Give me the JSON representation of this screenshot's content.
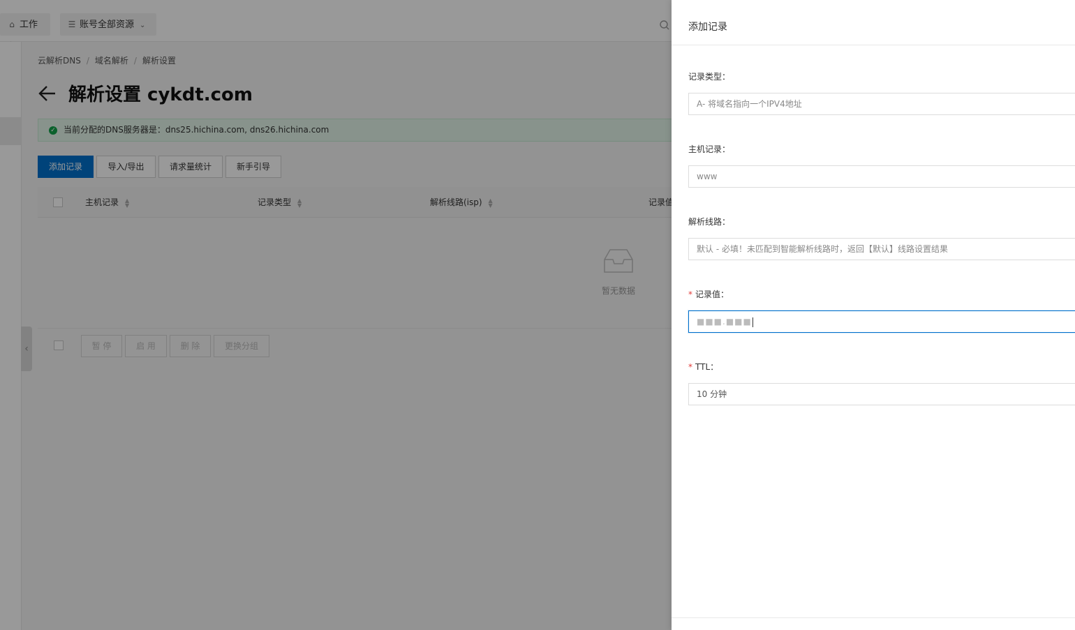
{
  "topbar": {
    "home_label": "工作台",
    "resource_label": "账号全部资源"
  },
  "breadcrumb": [
    "云解析DNS",
    "域名解析",
    "解析设置"
  ],
  "page": {
    "title": "解析设置 cykdt.com"
  },
  "alert": {
    "text": "当前分配的DNS服务器是：dns25.hichina.com, dns26.hichina.com"
  },
  "actions": {
    "add_record": "添加记录",
    "import_export": "导入/导出",
    "request_stats": "请求量统计",
    "guide": "新手引导"
  },
  "table": {
    "columns": [
      "主机记录",
      "记录类型",
      "解析线路(isp)",
      "记录值"
    ],
    "empty_text": "暂无数据",
    "bulk_actions": [
      "暂 停",
      "启 用",
      "删 除",
      "更换分组"
    ]
  },
  "drawer": {
    "title": "添加记录",
    "fields": [
      {
        "label": "记录类型：",
        "required": false,
        "value": "A- 将域名指向一个IPV4地址"
      },
      {
        "label": "主机记录：",
        "required": false,
        "value": "www"
      },
      {
        "label": "解析线路：",
        "required": false,
        "value": "默认 - 必填！未匹配到智能解析线路时，返回【默认】线路设置结果"
      },
      {
        "label": "记录值：",
        "required": true,
        "value": "■■■.■■■"
      },
      {
        "label": "TTL：",
        "required": true,
        "value": "10 分钟"
      }
    ]
  },
  "colors": {
    "primary": "#0070cc",
    "success": "#13a24a",
    "required": "#e23c39"
  }
}
